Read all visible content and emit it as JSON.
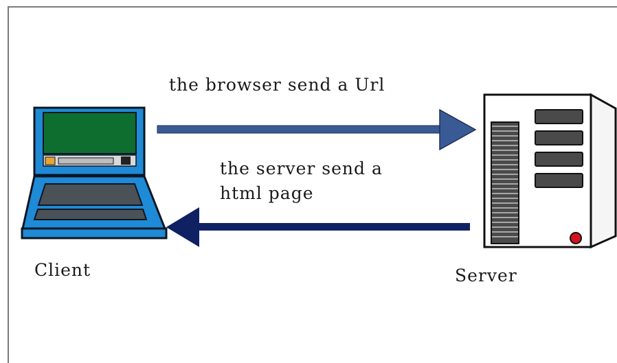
{
  "nodes": {
    "client": {
      "label": "Client",
      "icon": "laptop-icon"
    },
    "server": {
      "label": "Server",
      "icon": "server-tower-icon"
    }
  },
  "arrows": {
    "request": {
      "label": "the browser send a Url",
      "color": "#3a5a96"
    },
    "response": {
      "label_line1": "the server send a",
      "label_line2": "html page",
      "color": "#0f2163"
    }
  },
  "colors": {
    "laptop_body": "#1f8ad6",
    "laptop_screen": "#0d6e2f",
    "server_indicator": "#d3131b",
    "frame": "#7a7a7a"
  }
}
